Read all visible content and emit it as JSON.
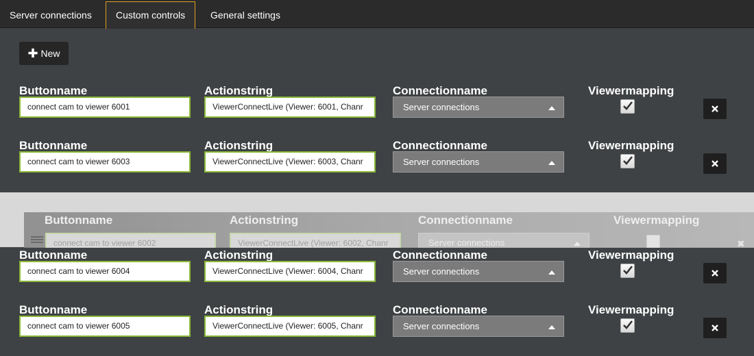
{
  "tabs": [
    {
      "label": "Server connections",
      "active": false
    },
    {
      "label": "Custom controls",
      "active": true
    },
    {
      "label": "General settings",
      "active": false
    }
  ],
  "toolbar": {
    "new_label": "New"
  },
  "labels": {
    "buttonname": "Buttonname",
    "actionstring": "Actionstring",
    "connectionname": "Connectionname",
    "viewermapping": "Viewermapping"
  },
  "rows": [
    {
      "buttonname": "connect cam to viewer 6001",
      "actionstring": "ViewerConnectLive (Viewer: 6001, Chanr",
      "connection": "Server connections",
      "viewermapping": true
    },
    {
      "buttonname": "connect cam to viewer 6003",
      "actionstring": "ViewerConnectLive (Viewer: 6003, Chanr",
      "connection": "Server connections",
      "viewermapping": true
    },
    {
      "buttonname": "connect cam to viewer 6004",
      "actionstring": "ViewerConnectLive (Viewer: 6004, Chanr",
      "connection": "Server connections",
      "viewermapping": true
    },
    {
      "buttonname": "connect cam to viewer 6005",
      "actionstring": "ViewerConnectLive (Viewer: 6005, Chanr",
      "connection": "Server connections",
      "viewermapping": true
    }
  ],
  "dragged_row": {
    "buttonname": "connect cam to viewer 6002",
    "actionstring": "ViewerConnectLive (Viewer: 6002, Chanr",
    "connection": "Server connections",
    "viewermapping": true,
    "delete_glyph": "✖"
  },
  "colors": {
    "accent_tab": "#e0a020",
    "field_border": "#8ab83a",
    "background": "#3f4244"
  }
}
